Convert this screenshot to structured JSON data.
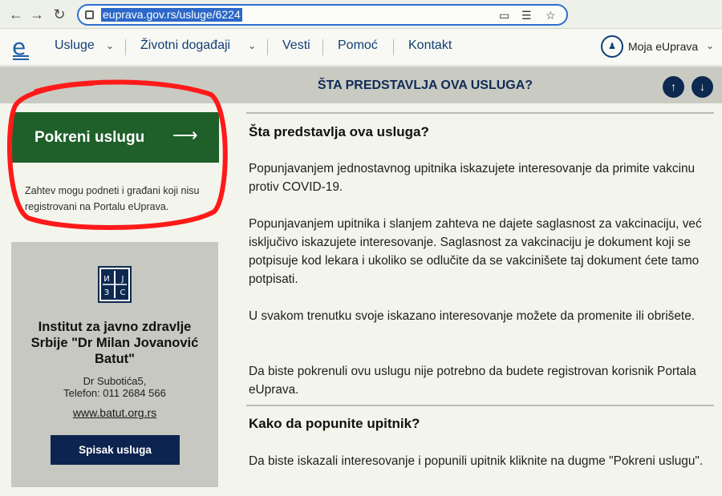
{
  "browser": {
    "url": "euprava.gov.rs/usluge/6224",
    "back_icon": "arrow-left-icon",
    "forward_icon": "arrow-right-icon",
    "reload_icon": "reload-icon"
  },
  "header": {
    "nav": [
      {
        "label": "Usluge",
        "has_dropdown": true
      },
      {
        "label": "Životni događaji",
        "has_dropdown": true
      },
      {
        "label": "Vesti",
        "has_dropdown": false
      },
      {
        "label": "Pomoć",
        "has_dropdown": false
      },
      {
        "label": "Kontakt",
        "has_dropdown": false
      }
    ],
    "account_label": "Moja eUprava"
  },
  "section_bar": {
    "title": "ŠTA PREDSTAVLJA OVA USLUGA?"
  },
  "sidebar": {
    "start_button_label": "Pokreni uslugu",
    "start_note": "Zahtev mogu podneti i građani koji nisu registrovani na Portalu eUprava.",
    "institution": {
      "logo_letters": [
        "И",
        "Ј",
        "З",
        "С"
      ],
      "name": "Institut za javno zdravlje Srbije \"Dr Milan Jovanović Batut\"",
      "address_line1": "Dr Subotića5,",
      "address_line2": "Telefon: 011 2684 566",
      "website": "www.batut.org.rs",
      "services_button_label": "Spisak usluga"
    }
  },
  "main": {
    "heading1": "Šta predstavlja ova usluga?",
    "paragraphs": [
      "Popunjavanjem jednostavnog upitnika iskazujete interesovanje da primite vakcinu protiv COVID-19.",
      "Popunjavanjem upitnika i slanjem zahteva ne dajete saglasnost za vakcinaciju, već isključivo iskazujete interesovanje. Saglasnost za vakcinaciju je dokument koji se potpisuje kod lekara i ukoliko se odlučite da se vakcinišete taj dokument ćete tamo potpisati.",
      "U svakom trenutku svoje iskazano interesovanje možete da promenite ili obrišete.",
      "Da biste pokrenuli ovu uslugu nije potrebno da budete registrovan korisnik Portala eUprava."
    ],
    "heading2": "Kako da popunite upitnik?",
    "paragraph_last": "Da biste iskazali interesovanje i popunili upitnik kliknite na dugme \"Pokreni uslugu\"."
  },
  "colors": {
    "start_button": "#1f5f2a",
    "navy": "#0d2950",
    "highlight_circle": "#ff1a1a"
  }
}
